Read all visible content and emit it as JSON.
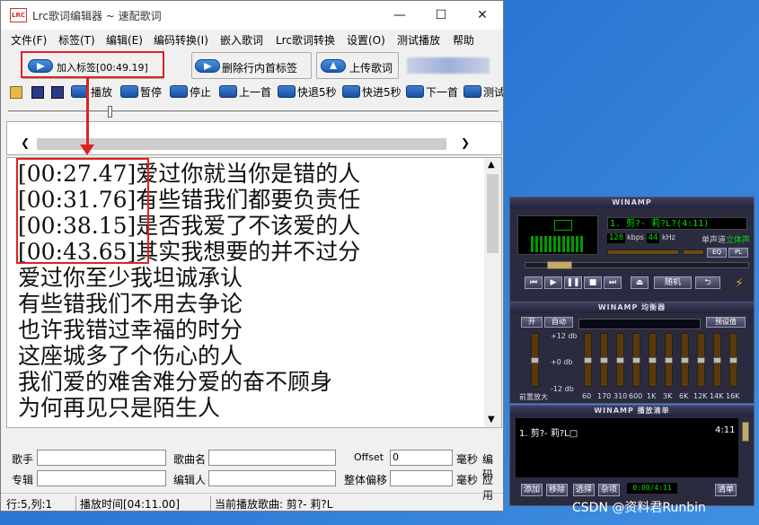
{
  "window": {
    "title": "Lrc歌词编辑器 ~ 速配歌词",
    "logo": "LRC",
    "min": "—",
    "max": "☐",
    "close": "✕"
  },
  "menu": [
    "文件(F)",
    "标签(T)",
    "编辑(E)",
    "编码转换(I)",
    "嵌入歌词",
    "Lrc歌词转换",
    "设置(O)",
    "测试播放",
    "帮助"
  ],
  "top_buttons": {
    "add_tag": "加入标签[00:49.19]",
    "delete_tag": "删除行内首标签",
    "upload": "上传歌词"
  },
  "toolbar": {
    "play": "播放",
    "pause": "暂停",
    "stop": "停止",
    "prev": "上一首",
    "back5": "快退5秒",
    "fwd5": "快进5秒",
    "next": "下一首",
    "test": "测试"
  },
  "lyrics": [
    "[00:27.47]爱过你就当你是错的人",
    "[00:31.76]有些错我们都要负责任",
    "[00:38.15]是否我爱了不该爱的人",
    "[00:43.65]其实我想要的并不过分",
    "爱过你至少我坦诚承认",
    "有些错我们不用去争论",
    "也许我错过幸福的时分",
    "这座城多了个伤心的人",
    "我们爱的难舍难分爱的奋不顾身",
    "为何再见只是陌生人"
  ],
  "fields": {
    "singer": "歌手",
    "song": "歌曲名",
    "offset": "Offset",
    "offset_value": "0",
    "ms1": "毫秒",
    "encoding": "编码",
    "album": "专辑",
    "editor": "编辑人",
    "overall": "整体偏移",
    "ms2": "毫秒",
    "apply": "应用"
  },
  "status": {
    "position": "行:5,列:1",
    "play_time": "播放时间[04:11.00]",
    "current_song": "当前播放歌曲: 剪?- 莉?L"
  },
  "winamp": {
    "title": "WINAMP",
    "track": "1. 剪?- 莉?L?(4:11)",
    "kbps_value": "128",
    "kbps": "kbps",
    "khz_value": "44",
    "khz": "kHz",
    "mono": "单声道",
    "stereo": "立体声",
    "eq_btn": "EQ",
    "pl_btn": "PL",
    "shuffle": "随机",
    "eq_title": "WINAMP 均衡器",
    "eq_on": "开",
    "eq_auto": "自动",
    "eq_presets": "预设值",
    "eq_plus": "+12 db",
    "eq_zero": "+0 db",
    "eq_minus": "-12 db",
    "eq_preamp": "前置放大",
    "eq_bands": [
      "60",
      "170",
      "310",
      "600",
      "1K",
      "3K",
      "6K",
      "12K",
      "14K",
      "16K"
    ],
    "pl_title": "WINAMP 播放清单",
    "pl_item": "1. 剪?- 莉?L□",
    "pl_time": "4:11",
    "pl_add": "添加",
    "pl_rem": "移除",
    "pl_sel": "选择",
    "pl_misc": "杂项",
    "pl_counter": "0:00/4:11",
    "pl_list": "清单"
  },
  "watermark": "CSDN @资料君Runbin",
  "colors": {
    "highlight": "#e02020",
    "lcd_green": "#00e000",
    "winamp_bg": "#2a2b3e"
  }
}
